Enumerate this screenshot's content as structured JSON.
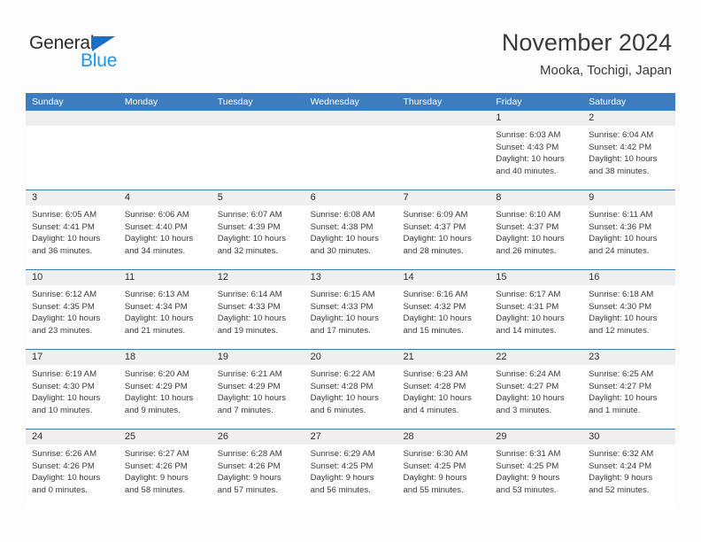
{
  "brand": {
    "name_part1": "General",
    "name_part2": "Blue",
    "triangle_color": "#1a6fc4",
    "blue_text_color": "#2196e8"
  },
  "header": {
    "title": "November 2024",
    "subtitle": "Mooka, Tochigi, Japan",
    "accent_color": "#3c7cbf"
  },
  "weekdays": [
    "Sunday",
    "Monday",
    "Tuesday",
    "Wednesday",
    "Thursday",
    "Friday",
    "Saturday"
  ],
  "weeks": [
    [
      {
        "day": "",
        "sunrise": "",
        "sunset": "",
        "daylight_line1": "",
        "daylight_line2": ""
      },
      {
        "day": "",
        "sunrise": "",
        "sunset": "",
        "daylight_line1": "",
        "daylight_line2": ""
      },
      {
        "day": "",
        "sunrise": "",
        "sunset": "",
        "daylight_line1": "",
        "daylight_line2": ""
      },
      {
        "day": "",
        "sunrise": "",
        "sunset": "",
        "daylight_line1": "",
        "daylight_line2": ""
      },
      {
        "day": "",
        "sunrise": "",
        "sunset": "",
        "daylight_line1": "",
        "daylight_line2": ""
      },
      {
        "day": "1",
        "sunrise": "Sunrise: 6:03 AM",
        "sunset": "Sunset: 4:43 PM",
        "daylight_line1": "Daylight: 10 hours",
        "daylight_line2": "and 40 minutes."
      },
      {
        "day": "2",
        "sunrise": "Sunrise: 6:04 AM",
        "sunset": "Sunset: 4:42 PM",
        "daylight_line1": "Daylight: 10 hours",
        "daylight_line2": "and 38 minutes."
      }
    ],
    [
      {
        "day": "3",
        "sunrise": "Sunrise: 6:05 AM",
        "sunset": "Sunset: 4:41 PM",
        "daylight_line1": "Daylight: 10 hours",
        "daylight_line2": "and 36 minutes."
      },
      {
        "day": "4",
        "sunrise": "Sunrise: 6:06 AM",
        "sunset": "Sunset: 4:40 PM",
        "daylight_line1": "Daylight: 10 hours",
        "daylight_line2": "and 34 minutes."
      },
      {
        "day": "5",
        "sunrise": "Sunrise: 6:07 AM",
        "sunset": "Sunset: 4:39 PM",
        "daylight_line1": "Daylight: 10 hours",
        "daylight_line2": "and 32 minutes."
      },
      {
        "day": "6",
        "sunrise": "Sunrise: 6:08 AM",
        "sunset": "Sunset: 4:38 PM",
        "daylight_line1": "Daylight: 10 hours",
        "daylight_line2": "and 30 minutes."
      },
      {
        "day": "7",
        "sunrise": "Sunrise: 6:09 AM",
        "sunset": "Sunset: 4:37 PM",
        "daylight_line1": "Daylight: 10 hours",
        "daylight_line2": "and 28 minutes."
      },
      {
        "day": "8",
        "sunrise": "Sunrise: 6:10 AM",
        "sunset": "Sunset: 4:37 PM",
        "daylight_line1": "Daylight: 10 hours",
        "daylight_line2": "and 26 minutes."
      },
      {
        "day": "9",
        "sunrise": "Sunrise: 6:11 AM",
        "sunset": "Sunset: 4:36 PM",
        "daylight_line1": "Daylight: 10 hours",
        "daylight_line2": "and 24 minutes."
      }
    ],
    [
      {
        "day": "10",
        "sunrise": "Sunrise: 6:12 AM",
        "sunset": "Sunset: 4:35 PM",
        "daylight_line1": "Daylight: 10 hours",
        "daylight_line2": "and 23 minutes."
      },
      {
        "day": "11",
        "sunrise": "Sunrise: 6:13 AM",
        "sunset": "Sunset: 4:34 PM",
        "daylight_line1": "Daylight: 10 hours",
        "daylight_line2": "and 21 minutes."
      },
      {
        "day": "12",
        "sunrise": "Sunrise: 6:14 AM",
        "sunset": "Sunset: 4:33 PM",
        "daylight_line1": "Daylight: 10 hours",
        "daylight_line2": "and 19 minutes."
      },
      {
        "day": "13",
        "sunrise": "Sunrise: 6:15 AM",
        "sunset": "Sunset: 4:33 PM",
        "daylight_line1": "Daylight: 10 hours",
        "daylight_line2": "and 17 minutes."
      },
      {
        "day": "14",
        "sunrise": "Sunrise: 6:16 AM",
        "sunset": "Sunset: 4:32 PM",
        "daylight_line1": "Daylight: 10 hours",
        "daylight_line2": "and 15 minutes."
      },
      {
        "day": "15",
        "sunrise": "Sunrise: 6:17 AM",
        "sunset": "Sunset: 4:31 PM",
        "daylight_line1": "Daylight: 10 hours",
        "daylight_line2": "and 14 minutes."
      },
      {
        "day": "16",
        "sunrise": "Sunrise: 6:18 AM",
        "sunset": "Sunset: 4:30 PM",
        "daylight_line1": "Daylight: 10 hours",
        "daylight_line2": "and 12 minutes."
      }
    ],
    [
      {
        "day": "17",
        "sunrise": "Sunrise: 6:19 AM",
        "sunset": "Sunset: 4:30 PM",
        "daylight_line1": "Daylight: 10 hours",
        "daylight_line2": "and 10 minutes."
      },
      {
        "day": "18",
        "sunrise": "Sunrise: 6:20 AM",
        "sunset": "Sunset: 4:29 PM",
        "daylight_line1": "Daylight: 10 hours",
        "daylight_line2": "and 9 minutes."
      },
      {
        "day": "19",
        "sunrise": "Sunrise: 6:21 AM",
        "sunset": "Sunset: 4:29 PM",
        "daylight_line1": "Daylight: 10 hours",
        "daylight_line2": "and 7 minutes."
      },
      {
        "day": "20",
        "sunrise": "Sunrise: 6:22 AM",
        "sunset": "Sunset: 4:28 PM",
        "daylight_line1": "Daylight: 10 hours",
        "daylight_line2": "and 6 minutes."
      },
      {
        "day": "21",
        "sunrise": "Sunrise: 6:23 AM",
        "sunset": "Sunset: 4:28 PM",
        "daylight_line1": "Daylight: 10 hours",
        "daylight_line2": "and 4 minutes."
      },
      {
        "day": "22",
        "sunrise": "Sunrise: 6:24 AM",
        "sunset": "Sunset: 4:27 PM",
        "daylight_line1": "Daylight: 10 hours",
        "daylight_line2": "and 3 minutes."
      },
      {
        "day": "23",
        "sunrise": "Sunrise: 6:25 AM",
        "sunset": "Sunset: 4:27 PM",
        "daylight_line1": "Daylight: 10 hours",
        "daylight_line2": "and 1 minute."
      }
    ],
    [
      {
        "day": "24",
        "sunrise": "Sunrise: 6:26 AM",
        "sunset": "Sunset: 4:26 PM",
        "daylight_line1": "Daylight: 10 hours",
        "daylight_line2": "and 0 minutes."
      },
      {
        "day": "25",
        "sunrise": "Sunrise: 6:27 AM",
        "sunset": "Sunset: 4:26 PM",
        "daylight_line1": "Daylight: 9 hours",
        "daylight_line2": "and 58 minutes."
      },
      {
        "day": "26",
        "sunrise": "Sunrise: 6:28 AM",
        "sunset": "Sunset: 4:26 PM",
        "daylight_line1": "Daylight: 9 hours",
        "daylight_line2": "and 57 minutes."
      },
      {
        "day": "27",
        "sunrise": "Sunrise: 6:29 AM",
        "sunset": "Sunset: 4:25 PM",
        "daylight_line1": "Daylight: 9 hours",
        "daylight_line2": "and 56 minutes."
      },
      {
        "day": "28",
        "sunrise": "Sunrise: 6:30 AM",
        "sunset": "Sunset: 4:25 PM",
        "daylight_line1": "Daylight: 9 hours",
        "daylight_line2": "and 55 minutes."
      },
      {
        "day": "29",
        "sunrise": "Sunrise: 6:31 AM",
        "sunset": "Sunset: 4:25 PM",
        "daylight_line1": "Daylight: 9 hours",
        "daylight_line2": "and 53 minutes."
      },
      {
        "day": "30",
        "sunrise": "Sunrise: 6:32 AM",
        "sunset": "Sunset: 4:24 PM",
        "daylight_line1": "Daylight: 9 hours",
        "daylight_line2": "and 52 minutes."
      }
    ]
  ]
}
